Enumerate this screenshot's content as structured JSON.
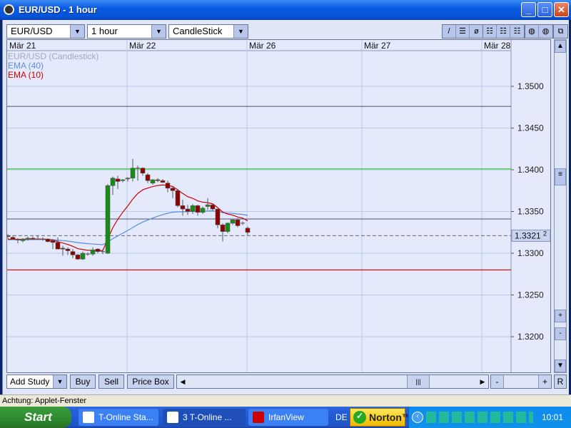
{
  "window": {
    "title": "EUR/USD - 1 hour",
    "min": "_",
    "max": "□",
    "close": "✕"
  },
  "toolbar": {
    "symbol": "EUR/USD",
    "interval": "1 hour",
    "chart_type": "CandleStick",
    "tools": [
      "/",
      "☰",
      "ø"
    ],
    "grid_tools": [
      "☷",
      "☷",
      "☷"
    ],
    "view_tools": [
      "◍",
      "◍"
    ],
    "detach": "⧉"
  },
  "chart": {
    "dates": [
      "Mär 21",
      "Mär 22",
      "Mär 26",
      "Mär 27",
      "Mär 28"
    ],
    "legend": [
      {
        "label": "EUR/USD (Candlestick)",
        "color": "#a0a8c0"
      },
      {
        "label": "EMA (40)",
        "color": "#5a8ee0"
      },
      {
        "label": "EMA (10)",
        "color": "#d00000"
      }
    ],
    "price_ticks": [
      "1.3500",
      "1.3450",
      "1.3400",
      "1.3350",
      "1.3300",
      "1.3250",
      "1.3200"
    ],
    "current_price": "1.3321",
    "current_price_sup": "2",
    "colors": {
      "up": "#168c16",
      "down": "#8c0000",
      "green_line": "#22cc22",
      "red_line": "#dd1111",
      "dark_line": "#4a5270"
    },
    "levels": {
      "green": 1.3401,
      "red": 1.328,
      "dark": [
        1.3476,
        1.3341
      ],
      "current": 1.3321
    },
    "ohlc": [
      [
        1.3321,
        1.3323,
        1.3317,
        1.332
      ],
      [
        1.3319,
        1.3321,
        1.3316,
        1.3317
      ],
      [
        1.3316,
        1.3318,
        1.3312,
        1.3316
      ],
      [
        1.3315,
        1.3318,
        1.3313,
        1.3317
      ],
      [
        1.3317,
        1.332,
        1.3315,
        1.3318
      ],
      [
        1.3318,
        1.332,
        1.3316,
        1.3317
      ],
      [
        1.3317,
        1.3321,
        1.3316,
        1.3317
      ],
      [
        1.3317,
        1.3319,
        1.3315,
        1.3317
      ],
      [
        1.3317,
        1.3318,
        1.3313,
        1.3314
      ],
      [
        1.3315,
        1.3317,
        1.3305,
        1.3313
      ],
      [
        1.3313,
        1.3319,
        1.3305,
        1.3305
      ],
      [
        1.3306,
        1.3309,
        1.3297,
        1.3305
      ],
      [
        1.3305,
        1.3307,
        1.3298,
        1.3303
      ],
      [
        1.3302,
        1.3305,
        1.3294,
        1.3298
      ],
      [
        1.3298,
        1.3299,
        1.3292,
        1.3293
      ],
      [
        1.3293,
        1.3302,
        1.3292,
        1.33
      ],
      [
        1.3299,
        1.3301,
        1.3297,
        1.3299
      ],
      [
        1.3299,
        1.3307,
        1.3297,
        1.3304
      ],
      [
        1.3305,
        1.3306,
        1.33,
        1.3302
      ],
      [
        1.3302,
        1.3305,
        1.3299,
        1.3302
      ],
      [
        1.33,
        1.3383,
        1.3299,
        1.3381
      ],
      [
        1.3381,
        1.3392,
        1.337,
        1.339
      ],
      [
        1.3389,
        1.3393,
        1.3377,
        1.3386
      ],
      [
        1.3387,
        1.3389,
        1.3385,
        1.3388
      ],
      [
        1.3389,
        1.3391,
        1.3386,
        1.339
      ],
      [
        1.339,
        1.3413,
        1.3386,
        1.3402
      ],
      [
        1.3402,
        1.3405,
        1.3387,
        1.3402
      ],
      [
        1.3402,
        1.3403,
        1.3393,
        1.3396
      ],
      [
        1.3394,
        1.3396,
        1.3384,
        1.3387
      ],
      [
        1.3384,
        1.3389,
        1.3382,
        1.3388
      ],
      [
        1.3388,
        1.339,
        1.3385,
        1.3387
      ],
      [
        1.3387,
        1.3389,
        1.3384,
        1.3385
      ],
      [
        1.3384,
        1.3387,
        1.3373,
        1.3378
      ],
      [
        1.3378,
        1.338,
        1.3366,
        1.3375
      ],
      [
        1.3375,
        1.3377,
        1.3355,
        1.3357
      ],
      [
        1.3357,
        1.3364,
        1.3345,
        1.3353
      ],
      [
        1.3353,
        1.3358,
        1.3346,
        1.335
      ],
      [
        1.335,
        1.3359,
        1.3347,
        1.3357
      ],
      [
        1.3357,
        1.3358,
        1.3345,
        1.3349
      ],
      [
        1.3349,
        1.3356,
        1.3347,
        1.3354
      ],
      [
        1.3356,
        1.3366,
        1.3352,
        1.3358
      ],
      [
        1.3358,
        1.3359,
        1.3351,
        1.3353
      ],
      [
        1.3353,
        1.3353,
        1.333,
        1.3334
      ],
      [
        1.3334,
        1.3336,
        1.3314,
        1.3326
      ],
      [
        1.3326,
        1.3337,
        1.3324,
        1.3336
      ],
      [
        1.3336,
        1.3341,
        1.3334,
        1.334
      ],
      [
        1.334,
        1.3342,
        1.3331,
        1.3333
      ],
      [
        1.3336,
        1.3338,
        1.3334,
        1.3336
      ],
      [
        1.333,
        1.3332,
        1.3322,
        1.3325
      ]
    ]
  },
  "bottom": {
    "add_study": "Add Study",
    "buy": "Buy",
    "sell": "Sell",
    "price_box": "Price Box",
    "left": "◀",
    "right": "▶",
    "thumb": "|||",
    "minus": "-",
    "plus": "+",
    "reset": "R"
  },
  "scroll": {
    "up": "▲",
    "down": "▼",
    "plus": "+",
    "minus": "-",
    "thumb": "≡"
  },
  "status": "Achtung: Applet-Fenster",
  "taskbar": {
    "start": "Start",
    "tasks": [
      "T-Online Sta...",
      "3  T-Online ...",
      "IrfanView"
    ],
    "lang": "DE",
    "norton": "Norton™",
    "clock": "10:01"
  }
}
